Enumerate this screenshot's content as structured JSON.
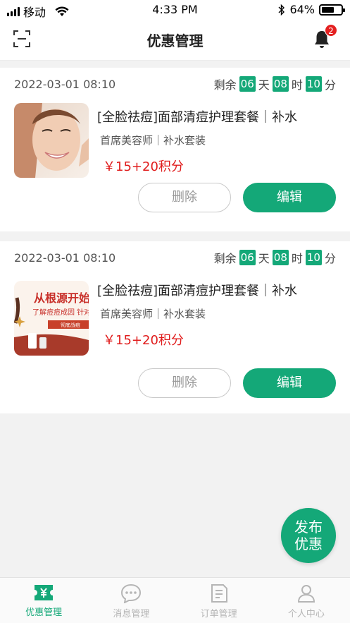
{
  "status_bar": {
    "carrier": "移动",
    "time": "4:33 PM",
    "battery": "64%",
    "battery_level": 0.64
  },
  "header": {
    "title": "优惠管理",
    "notification_count": "2"
  },
  "coupons": [
    {
      "date": "2022-03-01  08:10",
      "remaining_label": "剩余",
      "days": "06",
      "day_unit": "天",
      "hours": "08",
      "hour_unit": "时",
      "minutes": "10",
      "minute_unit": "分",
      "title": "[全脸祛痘]面部清痘护理套餐｜补水",
      "subtitle": "首席美容师｜补水套装",
      "price": "￥15+20积分",
      "delete_label": "删除",
      "edit_label": "编辑",
      "thumb_icon": "face-photo"
    },
    {
      "date": "2022-03-01  08:10",
      "remaining_label": "剩余",
      "days": "06",
      "day_unit": "天",
      "hours": "08",
      "hour_unit": "时",
      "minutes": "10",
      "minute_unit": "分",
      "title": "[全脸祛痘]面部清痘护理套餐｜补水",
      "subtitle": "首席美容师｜补水套装",
      "price": "￥15+20积分",
      "delete_label": "删除",
      "edit_label": "编辑",
      "thumb_icon": "promo-banner",
      "thumb_text_1": "从根源开始",
      "thumb_text_2": "了解痘痘成因 针对",
      "thumb_text_3": "彻底战痘"
    }
  ],
  "fab": {
    "line1": "发布",
    "line2": "优惠"
  },
  "tabs": [
    {
      "label": "优惠管理",
      "icon": "coupon-icon",
      "active": true
    },
    {
      "label": "消息管理",
      "icon": "chat-icon",
      "active": false
    },
    {
      "label": "订单管理",
      "icon": "document-icon",
      "active": false
    },
    {
      "label": "个人中心",
      "icon": "person-icon",
      "active": false
    }
  ],
  "colors": {
    "accent": "#14a878",
    "price": "#e01c1c",
    "badge": "#e42020"
  }
}
